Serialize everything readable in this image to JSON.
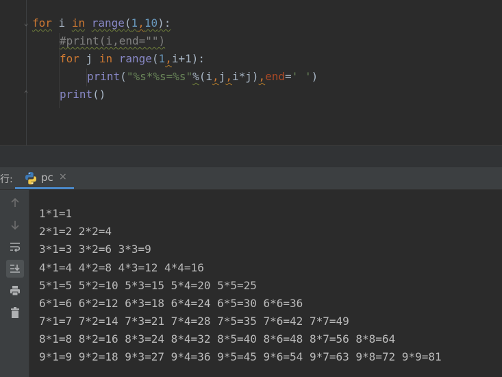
{
  "editor": {
    "lines": [
      [
        "for",
        "i",
        "in",
        "range",
        "(",
        "1",
        ",",
        "10",
        "):"
      ],
      [
        "#print(i,end=\"\")"
      ],
      [
        "for",
        "j",
        "in",
        "range",
        "(",
        "1",
        ",",
        "i+1",
        "):"
      ],
      [
        "print",
        "(",
        "\"%s*%s=%s\"",
        "%",
        "(i",
        ",",
        "j",
        ",",
        "i*j)",
        ",",
        "end",
        "=",
        "' '",
        ")"
      ],
      [
        "print",
        "()"
      ]
    ]
  },
  "run_panel": {
    "label": "运行:",
    "tab_name": "pc",
    "tab_close": "×"
  },
  "console": {
    "lines": [
      "1*1=1",
      "2*1=2 2*2=4",
      "3*1=3 3*2=6 3*3=9",
      "4*1=4 4*2=8 4*3=12 4*4=16",
      "5*1=5 5*2=10 5*3=15 5*4=20 5*5=25",
      "6*1=6 6*2=12 6*3=18 6*4=24 6*5=30 6*6=36",
      "7*1=7 7*2=14 7*3=21 7*4=28 7*5=35 7*6=42 7*7=49",
      "8*1=8 8*2=16 8*3=24 8*4=32 8*5=40 8*6=48 8*7=56 8*8=64",
      "9*1=9 9*2=18 9*3=27 9*4=36 9*5=45 9*6=54 9*7=63 9*8=72 9*9=81"
    ]
  },
  "toolbar_icons": [
    "up-arrow-icon",
    "down-arrow-icon",
    "soft-wrap-icon",
    "scroll-to-end-icon",
    "print-icon",
    "trash-icon"
  ],
  "colors": {
    "keyword": "#cc7832",
    "builtin": "#8888c6",
    "number": "#6897bb",
    "string": "#6a8759",
    "comment": "#808080",
    "param": "#aa4926",
    "text": "#a9b7c6",
    "accent_tab": "#4a88c7"
  }
}
